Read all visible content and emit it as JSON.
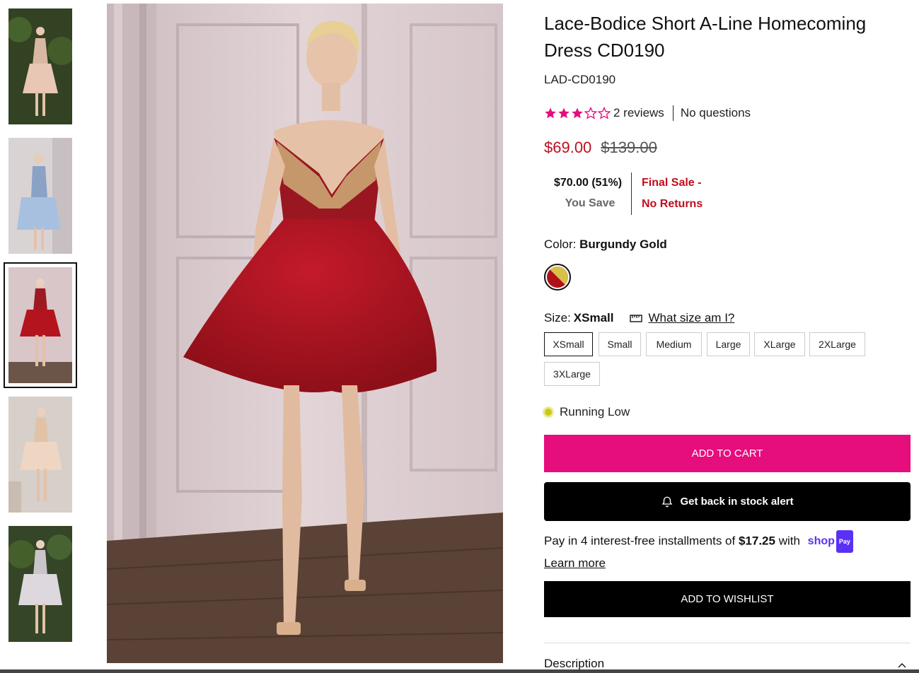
{
  "gallery": {
    "thumbnails": [
      {
        "alt": "thumbnail-1"
      },
      {
        "alt": "thumbnail-2"
      },
      {
        "alt": "thumbnail-3"
      },
      {
        "alt": "thumbnail-4"
      },
      {
        "alt": "thumbnail-5"
      }
    ],
    "selected_index": 2
  },
  "product": {
    "title": "Lace-Bodice Short A-Line Homecoming Dress CD0190",
    "sku": "LAD-CD0190",
    "rating": 3,
    "rating_max": 5,
    "reviews_text": "2 reviews",
    "questions_text": "No questions",
    "price_now": "$69.00",
    "price_was": "$139.00",
    "save_amount": "$70.00 (51%)",
    "save_label": "You Save",
    "final_sale_line1": "Final Sale -",
    "final_sale_line2": "No Returns",
    "color_label": "Color:",
    "color_value": "Burgundy Gold",
    "swatch_colors": [
      "#b0121b",
      "#d9c04a"
    ],
    "size_label": "Size:",
    "size_value": "XSmall",
    "size_guide": "What size am I?",
    "sizes": [
      "XSmall",
      "Small",
      "Medium",
      "Large",
      "XLarge",
      "2XLarge",
      "3XLarge"
    ],
    "stock_status": "Running Low",
    "add_to_cart": "ADD TO CART",
    "stock_alert": "Get back in stock alert",
    "installments_prefix": "Pay in 4 interest-free installments of ",
    "installments_amount": "$17.25",
    "installments_suffix": " with",
    "shop_pay_word": "shop",
    "shop_pay_pill": "Pay",
    "learn_more": "Learn more",
    "add_to_wishlist": "ADD TO WISHLIST",
    "description_label": "Description"
  },
  "colors": {
    "accent_pink": "#e60d7d",
    "sale_red": "#c00d1e",
    "star_pink": "#e60d7d",
    "shop_pay_purple": "#5a31f4"
  }
}
